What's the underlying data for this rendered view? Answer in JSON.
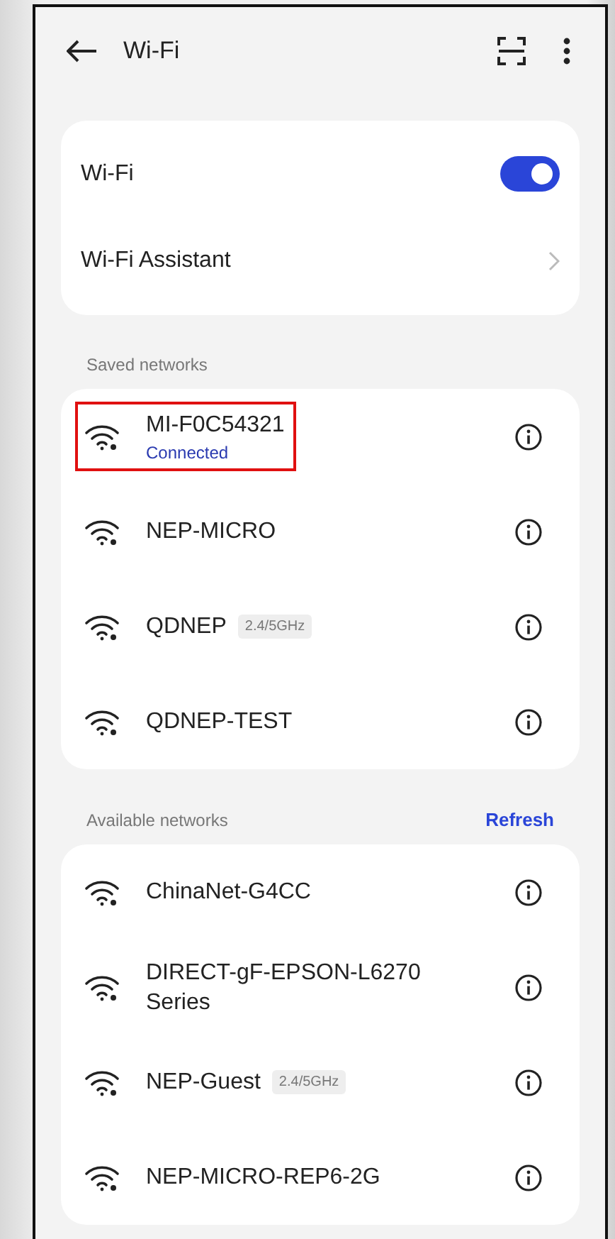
{
  "header": {
    "title": "Wi-Fi"
  },
  "settings": {
    "wifi_label": "Wi-Fi",
    "wifi_on": true,
    "assistant_label": "Wi-Fi Assistant"
  },
  "saved_networks": {
    "title": "Saved networks",
    "items": [
      {
        "name": "MI-F0C54321",
        "status": "Connected",
        "highlighted": true
      },
      {
        "name": "NEP-MICRO",
        "highlighted": false
      },
      {
        "name": "QDNEP",
        "band": "2.4/5GHz",
        "highlighted": false
      },
      {
        "name": "QDNEP-TEST",
        "highlighted": false
      }
    ]
  },
  "available_networks": {
    "title": "Available networks",
    "action": "Refresh",
    "items": [
      {
        "name": "ChinaNet-G4CC"
      },
      {
        "name": "DIRECT-gF-EPSON-L6270 Series"
      },
      {
        "name": "NEP-Guest",
        "band": "2.4/5GHz"
      },
      {
        "name": "NEP-MICRO-REP6-2G"
      }
    ]
  }
}
